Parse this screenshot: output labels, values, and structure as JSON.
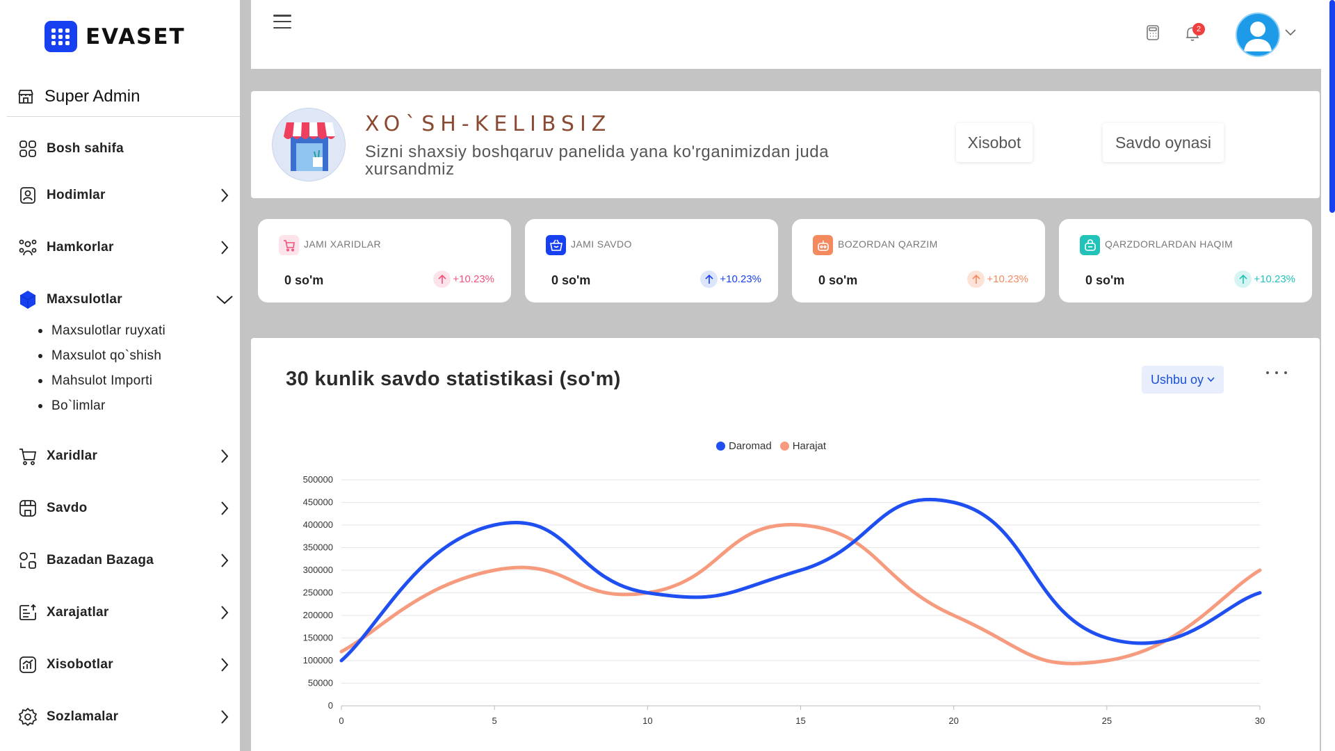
{
  "brand": {
    "name": "EVASET",
    "accent": "#1740f0"
  },
  "sidebar": {
    "role": "Super Admin",
    "items": [
      {
        "label": "Bosh sahifa",
        "icon": "grid-icon"
      },
      {
        "label": "Hodimlar",
        "icon": "user-badge-icon"
      },
      {
        "label": "Hamkorlar",
        "icon": "users-group-icon"
      },
      {
        "label": "Maxsulotlar",
        "icon": "hexagon-icon"
      },
      {
        "label": "Xaridlar",
        "icon": "cart-icon"
      },
      {
        "label": "Savdo",
        "icon": "store-icon"
      },
      {
        "label": "Bazadan Bazaga",
        "icon": "transfer-icon"
      },
      {
        "label": "Xarajatlar",
        "icon": "expense-icon"
      },
      {
        "label": "Xisobotlar",
        "icon": "report-chart-icon"
      },
      {
        "label": "Sozlamalar",
        "icon": "gear-icon"
      }
    ],
    "subitems": [
      "Maxsulotlar ruyxati",
      "Maxsulot qo`shish",
      "Mahsulot Importi",
      "Bo`limlar"
    ]
  },
  "header": {
    "notification_count": "2"
  },
  "welcome": {
    "title": "XO`SH-KELIBSIZ",
    "subtitle": "Sizni shaxsiy boshqaruv panelida yana ko'rganimizdan juda xursandmiz",
    "report_button": "Xisobot",
    "sales_button": "Savdo oynasi"
  },
  "stats": [
    {
      "label": "JAMI XARIDLAR",
      "value": "0 so'm",
      "change": "+10.23%",
      "color": "#f0527a",
      "soft": "#fde4ea"
    },
    {
      "label": "JAMI SAVDO",
      "value": "0 so'm",
      "change": "+10.23%",
      "color": "#1740f0",
      "soft": "#dde5fb"
    },
    {
      "label": "BOZORDAN QARZIM",
      "value": "0 so'm",
      "change": "+10.23%",
      "color": "#f4895e",
      "soft": "#fde3d7"
    },
    {
      "label": "QARZDORLARDAN HAQIM",
      "value": "0 so'm",
      "change": "+10.23%",
      "color": "#22c2b8",
      "soft": "#d6f5f2"
    }
  ],
  "chart": {
    "title": "30 kunlik savdo statistikasi (so'm)",
    "period_select": "Ushbu oy"
  },
  "chart_data": {
    "type": "line",
    "x": [
      0,
      5,
      10,
      15,
      20,
      25,
      30
    ],
    "series": [
      {
        "name": "Daromad",
        "color": "#1f4ff0",
        "values": [
          100000,
          400000,
          250000,
          300000,
          450000,
          150000,
          250000
        ]
      },
      {
        "name": "Harajat",
        "color": "#f79b7e",
        "values": [
          120000,
          300000,
          250000,
          400000,
          200000,
          100000,
          300000
        ]
      }
    ],
    "xlim": [
      0,
      30
    ],
    "ylim": [
      0,
      500000
    ],
    "yticks": [
      0,
      50000,
      100000,
      150000,
      200000,
      250000,
      300000,
      350000,
      400000,
      450000,
      500000
    ],
    "xticks": [
      0,
      5,
      10,
      15,
      20,
      25,
      30
    ],
    "grid": true,
    "legend": "top-center"
  }
}
